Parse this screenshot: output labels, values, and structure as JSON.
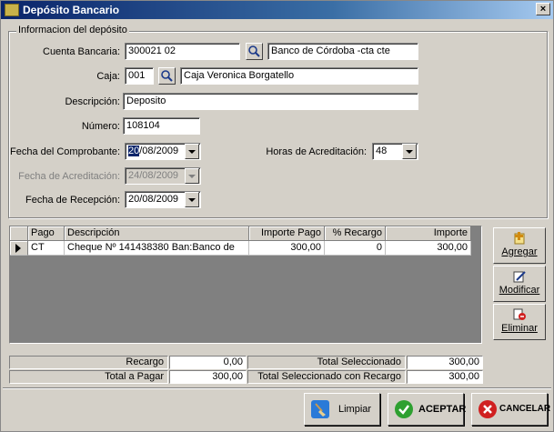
{
  "window": {
    "title": "Depósito Bancario",
    "close_glyph": "×"
  },
  "group": {
    "legend": "Informacion del depósito",
    "cuenta_bancaria": {
      "label": "Cuenta Bancaria:",
      "code": "300021 02",
      "name": "Banco de Córdoba -cta cte"
    },
    "caja": {
      "label": "Caja:",
      "code": "001",
      "name": "Caja Veronica Borgatello"
    },
    "descripcion": {
      "label": "Descripción:",
      "value": "Deposito"
    },
    "numero": {
      "label": "Número:",
      "value": "108104"
    },
    "fecha_comprobante": {
      "label": "Fecha del Comprobante:",
      "selected_part": "20",
      "rest": "/08/2009"
    },
    "horas_acreditacion": {
      "label": "Horas de Acreditación:",
      "value": "48"
    },
    "fecha_acreditacion": {
      "label": "Fecha de Acreditación:",
      "value": "24/08/2009"
    },
    "fecha_recepcion": {
      "label": "Fecha de Recepción:",
      "value": "20/08/2009"
    }
  },
  "grid": {
    "columns": [
      "Pago",
      "Descripción",
      "Importe Pago",
      "% Recargo",
      "Importe"
    ],
    "rows": [
      {
        "pago": "CT",
        "descripcion": "Cheque Nº 141438380 Ban:Banco de",
        "importe_pago": "300,00",
        "recargo": "0",
        "importe": "300,00"
      }
    ]
  },
  "side_buttons": {
    "agregar": "Agregar",
    "modificar": "Modificar",
    "eliminar": "Eliminar"
  },
  "totals": {
    "recargo_label": "Recargo",
    "recargo_value": "0,00",
    "total_pagar_label": "Total a Pagar",
    "total_pagar_value": "300,00",
    "total_sel_label": "Total Seleccionado",
    "total_sel_value": "300,00",
    "total_sel_rec_label": "Total Seleccionado con Recargo",
    "total_sel_rec_value": "300,00"
  },
  "buttons": {
    "limpiar": "Limpiar",
    "aceptar": "ACEPTAR",
    "cancelar": "CANCELAR"
  },
  "icons": {
    "search": "search-icon",
    "add": "add-icon",
    "edit": "edit-icon",
    "delete": "delete-icon",
    "broom": "broom-icon",
    "check": "check-icon",
    "cancel": "cancel-icon"
  }
}
